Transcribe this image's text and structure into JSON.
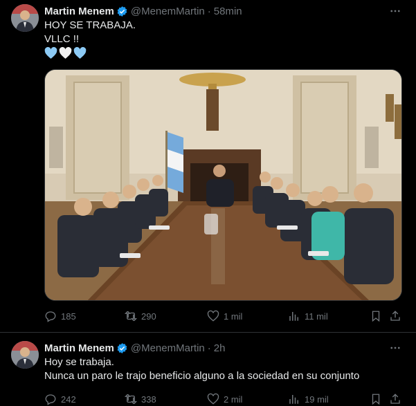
{
  "colors": {
    "background": "#000000",
    "text": "#e7e9ea",
    "secondary": "#71767b",
    "verified": "#1d9bf0",
    "divider": "#2f3336"
  },
  "tweets": [
    {
      "author": {
        "name": "Martin Menem",
        "handle": "@MenemMartin",
        "verified": true
      },
      "time": "58min",
      "lines": [
        "HOY SE TRABAJA.",
        "VLLC !!"
      ],
      "emoji": [
        "light-blue-heart",
        "white-heart",
        "light-blue-heart"
      ],
      "has_photo": true,
      "stats": {
        "replies": "185",
        "reposts": "290",
        "likes": "1 mil",
        "views": "11 mil"
      }
    },
    {
      "author": {
        "name": "Martin Menem",
        "handle": "@MenemMartin",
        "verified": true
      },
      "time": "2h",
      "lines": [
        "Hoy se trabaja.",
        "Nunca un paro le trajo beneficio alguno a la sociedad en su conjunto"
      ],
      "stats": {
        "replies": "242",
        "reposts": "338",
        "likes": "2 mil",
        "views": "19 mil"
      }
    }
  ]
}
